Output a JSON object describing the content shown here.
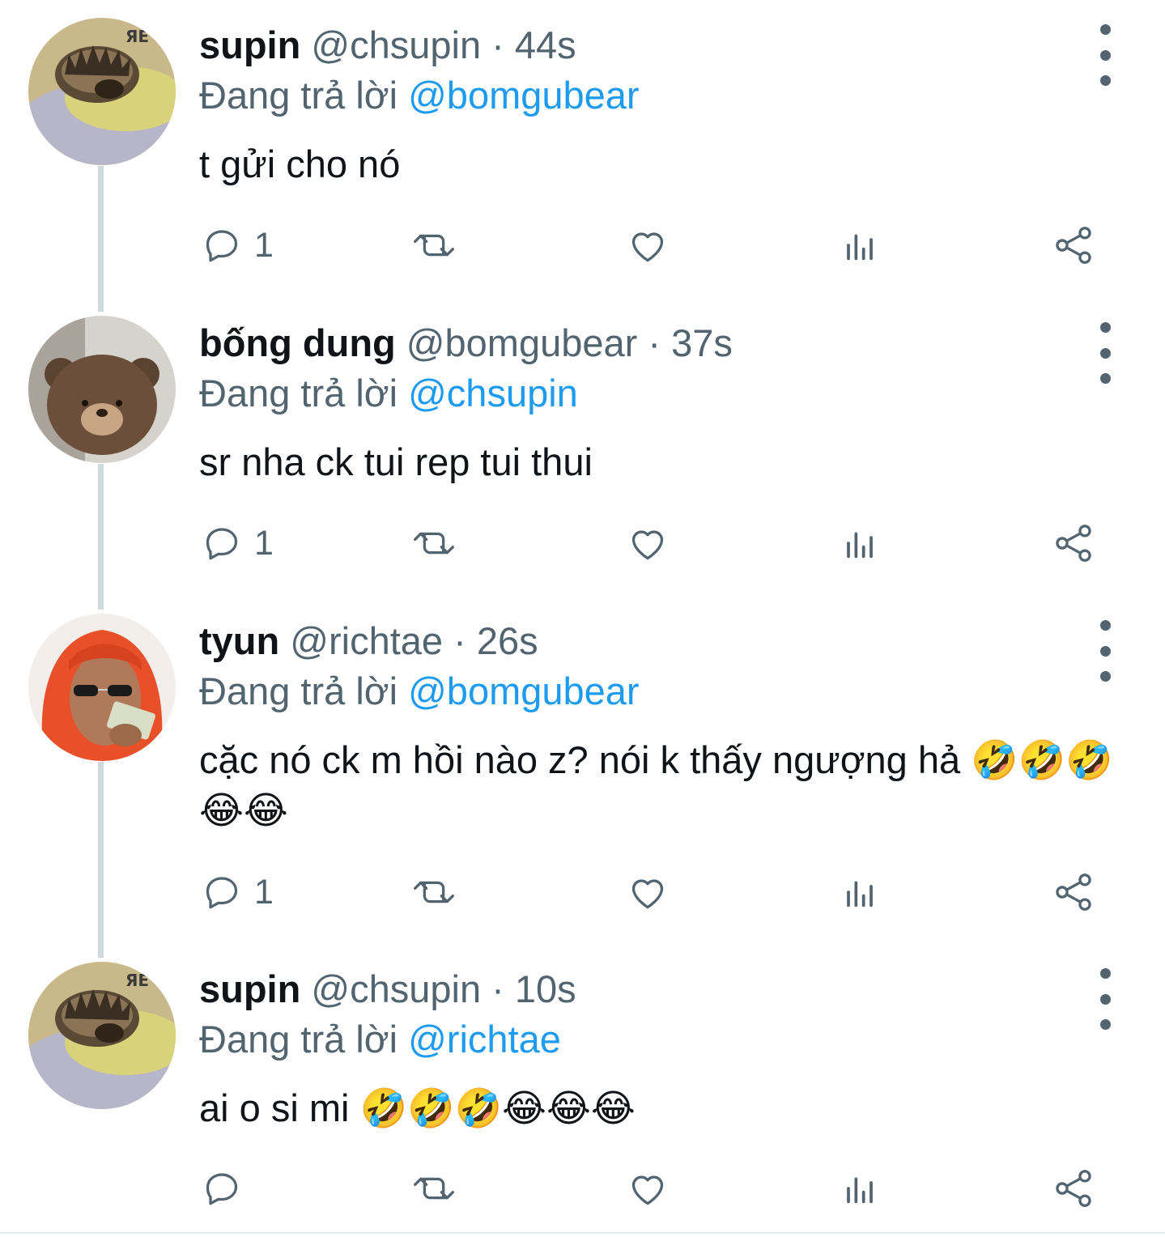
{
  "colors": {
    "text": "#0f1419",
    "muted": "#536471",
    "link": "#1d9bf0",
    "thread_line": "#cfd9de"
  },
  "tweets": [
    {
      "name": "supin",
      "handle": "@chsupin",
      "time": "44s",
      "replying_label": "Đang trả lời",
      "replying_to": "@bomgubear",
      "text": "t gửi cho nó",
      "reply_count": "1",
      "avatar": "hedgehog-avatar"
    },
    {
      "name": "bống dung",
      "handle": "@bomgubear",
      "time": "37s",
      "replying_label": "Đang trả lời",
      "replying_to": "@chsupin",
      "text": "sr nha ck tui rep tui thui",
      "reply_count": "1",
      "avatar": "brown-bear-avatar"
    },
    {
      "name": "tyun",
      "handle": "@richtae",
      "time": "26s",
      "replying_label": "Đang trả lời",
      "replying_to": "@bomgubear",
      "text": "cặc nó ck m hồi nào z? nói k thấy ngượng hả 🤣🤣🤣😂😂",
      "reply_count": "1",
      "avatar": "red-hair-woman-avatar"
    },
    {
      "name": "supin",
      "handle": "@chsupin",
      "time": "10s",
      "replying_label": "Đang trả lời",
      "replying_to": "@richtae",
      "text": "ai o si mi 🤣🤣🤣😂😂😂",
      "reply_count": "",
      "avatar": "hedgehog-avatar"
    }
  ],
  "separator": "·"
}
